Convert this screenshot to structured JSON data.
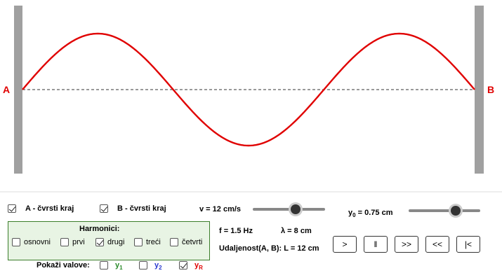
{
  "wave": {
    "end_a_label": "A",
    "end_b_label": "B",
    "wave_color": "#e00000",
    "wall_color": "#a0a0a0",
    "end_label_color": "#e00000",
    "harmonic": 3
  },
  "controls": {
    "a_fixed": {
      "label": "A - čvrsti kraj",
      "checked": true
    },
    "b_fixed": {
      "label": "B - čvrsti kraj",
      "checked": true
    },
    "speed": {
      "label": "v = 12 cm/s",
      "position": 0.59
    },
    "amplitude": {
      "label_main": "y",
      "label_sub": "0",
      "label_rest": " = 0.75 cm",
      "position": 0.66
    },
    "frequency": "f = 1.5 Hz",
    "wavelength": "λ = 8 cm",
    "distance": "Udaljenost(A, B): L = 12 cm"
  },
  "harmonics": {
    "title": "Harmonici:",
    "items": [
      {
        "label": "osnovni",
        "checked": false
      },
      {
        "label": "prvi",
        "checked": false
      },
      {
        "label": "drugi",
        "checked": true
      },
      {
        "label": "treći",
        "checked": false
      },
      {
        "label": "četvrti",
        "checked": false
      }
    ]
  },
  "show_waves": {
    "label": "Pokaži valove:",
    "y1": {
      "main": "y",
      "sub": "1",
      "color": "#2a8a2a",
      "checked": false
    },
    "y2": {
      "main": "y",
      "sub": "2",
      "color": "#2a3ad0",
      "checked": false
    },
    "yR": {
      "main": "y",
      "sub": "R",
      "color": "#e00000",
      "checked": true
    }
  },
  "buttons": [
    ">",
    "‖",
    ">>",
    "<<",
    "|<"
  ]
}
